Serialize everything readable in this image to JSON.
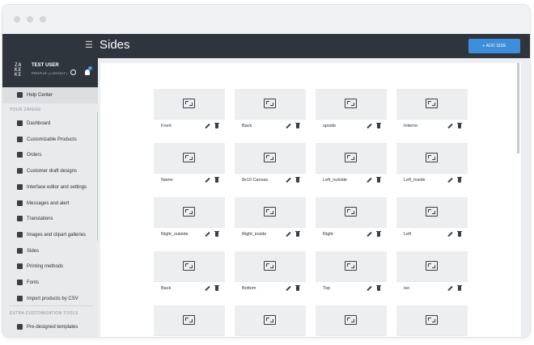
{
  "header": {
    "menu_icon": "hamburger-icon",
    "title": "Sides",
    "add_button": "+ ADD SIDE"
  },
  "user": {
    "logo": "ZAKEKE",
    "name": "TEST USER",
    "links": "PROFILE | LOGOUT |",
    "notification_count": "2"
  },
  "sidebar": {
    "help": "Help Center",
    "section_main": "YOUR ZAKEKE",
    "items": [
      {
        "label": "Dashboard",
        "icon": "dashboard-icon"
      },
      {
        "label": "Customizable Products",
        "icon": "basket-icon"
      },
      {
        "label": "Orders",
        "icon": "cart-icon"
      },
      {
        "label": "Customer draft designs",
        "icon": "draft-icon"
      },
      {
        "label": "Interface editor and settings",
        "icon": "paint-roller-icon"
      },
      {
        "label": "Messages and alert",
        "icon": "message-icon"
      },
      {
        "label": "Translations",
        "icon": "translate-icon"
      },
      {
        "label": "Images and clipart galleries",
        "icon": "image-icon"
      },
      {
        "label": "Sides",
        "icon": "sides-icon"
      },
      {
        "label": "Printing methods",
        "icon": "printing-icon"
      },
      {
        "label": "Fonts",
        "icon": "font-icon"
      },
      {
        "label": "Import products by CSV",
        "icon": "file-icon"
      }
    ],
    "section_extra": "EXTRA CUSTOMIZATION TOOLS",
    "extra_items": [
      {
        "label": "Pre-designed templates",
        "icon": "template-icon"
      }
    ]
  },
  "sides": [
    "Front",
    "Back",
    "upside",
    "Interno",
    "Name",
    "8x10 Canvas",
    "Left_outside",
    "Left_inside",
    "Right_outside",
    "Right_inside",
    "Right",
    "Left",
    "Back",
    "Bottom",
    "Top",
    "iso",
    "",
    "",
    "",
    ""
  ],
  "colors": {
    "topbar": "#2f353c",
    "accent": "#3e8edb",
    "sidebar": "#e9eaec"
  }
}
